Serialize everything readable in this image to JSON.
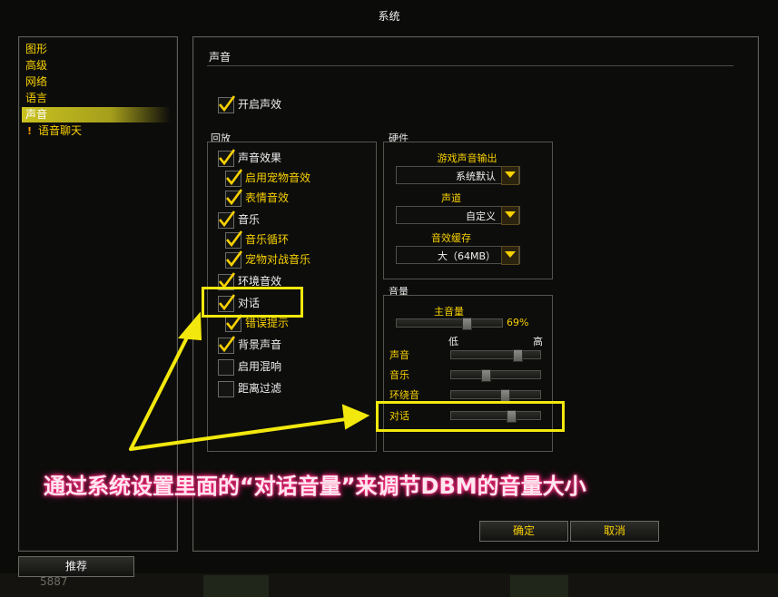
{
  "window": {
    "title": "系统"
  },
  "categories": {
    "items": [
      "图形",
      "高级",
      "网络",
      "语言",
      "声音"
    ],
    "voice_chat": "语音聊天",
    "recommend_button": "推荐",
    "ghost_number": "5887"
  },
  "sound": {
    "section_title": "声音",
    "enable_sound": "开启声效",
    "playback_group": "回放",
    "playback": [
      {
        "label": "声音效果",
        "checked": true,
        "indent": false
      },
      {
        "label": "启用宠物音效",
        "checked": true,
        "indent": true
      },
      {
        "label": "表情音效",
        "checked": true,
        "indent": true
      },
      {
        "label": "音乐",
        "checked": true,
        "indent": false
      },
      {
        "label": "音乐循环",
        "checked": true,
        "indent": true
      },
      {
        "label": "宠物对战音乐",
        "checked": true,
        "indent": true
      },
      {
        "label": "环境音效",
        "checked": true,
        "indent": false
      },
      {
        "label": "对话",
        "checked": true,
        "indent": false
      },
      {
        "label": "错误提示",
        "checked": true,
        "indent": true
      },
      {
        "label": "背景声音",
        "checked": true,
        "indent": false
      },
      {
        "label": "启用混响",
        "checked": false,
        "indent": false
      },
      {
        "label": "距离过滤",
        "checked": false,
        "indent": false
      }
    ],
    "hardware_group": "硬件",
    "output_label": "游戏声音输出",
    "output_value": "系统默认",
    "channel_label": "声道",
    "channel_value": "自定义",
    "cache_label": "音效缓存",
    "cache_value": "大（64MB）",
    "volume_group": "音量",
    "master_label": "主音量",
    "master_value": "69%",
    "master_level": 0.69,
    "low_label": "低",
    "high_label": "高",
    "volumes": [
      {
        "label": "声音",
        "level": 0.78
      },
      {
        "label": "音乐",
        "level": 0.38
      },
      {
        "label": "环绕音",
        "level": 0.62
      },
      {
        "label": "对话",
        "level": 0.7
      }
    ],
    "ok_button": "确定",
    "cancel_button": "取消"
  },
  "annotation": {
    "caption": "通过系统设置里面的“对话音量”来调节DBM的音量大小",
    "highlight_color": "#f2e80d",
    "caption_glow": "#ff2a80"
  }
}
